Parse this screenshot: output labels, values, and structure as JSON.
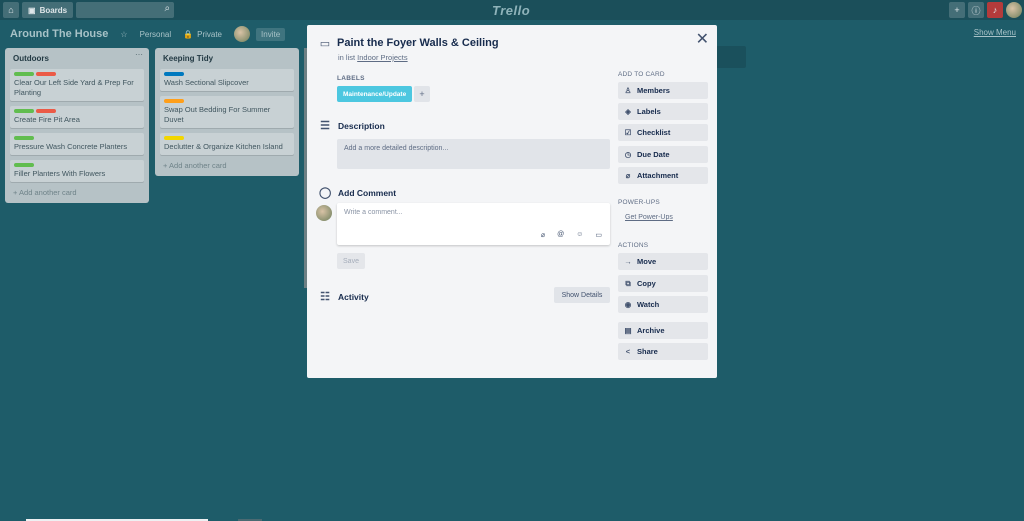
{
  "topbar": {
    "home_icon": "home-icon",
    "boards_label": "Boards",
    "search_icon": "search-icon",
    "logo": "Trello",
    "right_icons": [
      "plus-icon",
      "info-icon",
      "bell-icon",
      "avatar"
    ]
  },
  "board": {
    "title": "Around The House",
    "visibility_team": "Personal",
    "visibility_privacy": "Private",
    "invite_label": "Invite",
    "show_menu": "Show Menu"
  },
  "lists": [
    {
      "title": "Outdoors",
      "cards": [
        {
          "text": "Clear Our Left Side Yard & Prep For Planting",
          "labels": [
            "#61bd4f",
            "#eb5a46"
          ]
        },
        {
          "text": "Create Fire Pit Area",
          "labels": [
            "#61bd4f",
            "#eb5a46"
          ]
        },
        {
          "text": "Pressure Wash Concrete Planters",
          "labels": [
            "#61bd4f"
          ]
        },
        {
          "text": "Filler Planters With Flowers",
          "labels": [
            "#61bd4f"
          ]
        }
      ],
      "add_card": "+ Add another card"
    },
    {
      "title": "Keeping Tidy",
      "cards": [
        {
          "text": "Wash Sectional Slipcover",
          "labels": [
            "#0079bf"
          ]
        },
        {
          "text": "Swap Out Bedding For Summer Duvet",
          "labels": [
            "#ff9f1a"
          ]
        },
        {
          "text": "Declutter & Organize Kitchen Island",
          "labels": [
            "#f2d600"
          ]
        }
      ],
      "add_card": "+ Add another card"
    }
  ],
  "modal": {
    "card_title": "Paint the Foyer Walls & Ceiling",
    "in_list_prefix": "in list ",
    "in_list_name": "Indoor Projects",
    "labels_heading": "LABELS",
    "label_chip": "Maintenance/Update",
    "label_add": "+",
    "description_heading": "Description",
    "description_placeholder": "Add a more detailed description...",
    "comment_heading": "Add Comment",
    "comment_placeholder": "Write a comment...",
    "save_label": "Save",
    "activity_heading": "Activity",
    "show_details_label": "Show Details",
    "sidebar": {
      "add_to_card_heading": "ADD TO CARD",
      "add_to_card": [
        {
          "icon": "person-icon",
          "label": "Members"
        },
        {
          "icon": "tag-icon",
          "label": "Labels"
        },
        {
          "icon": "checklist-icon",
          "label": "Checklist"
        },
        {
          "icon": "clock-icon",
          "label": "Due Date"
        },
        {
          "icon": "paperclip-icon",
          "label": "Attachment"
        }
      ],
      "powerups_heading": "POWER-UPS",
      "get_powerups": "Get Power-Ups",
      "actions_heading": "ACTIONS",
      "actions": [
        {
          "icon": "arrow-right-icon",
          "label": "Move"
        },
        {
          "icon": "copy-icon",
          "label": "Copy"
        },
        {
          "icon": "eye-icon",
          "label": "Watch"
        },
        {
          "icon": "archive-icon",
          "label": "Archive"
        },
        {
          "icon": "share-icon",
          "label": "Share"
        }
      ]
    }
  }
}
